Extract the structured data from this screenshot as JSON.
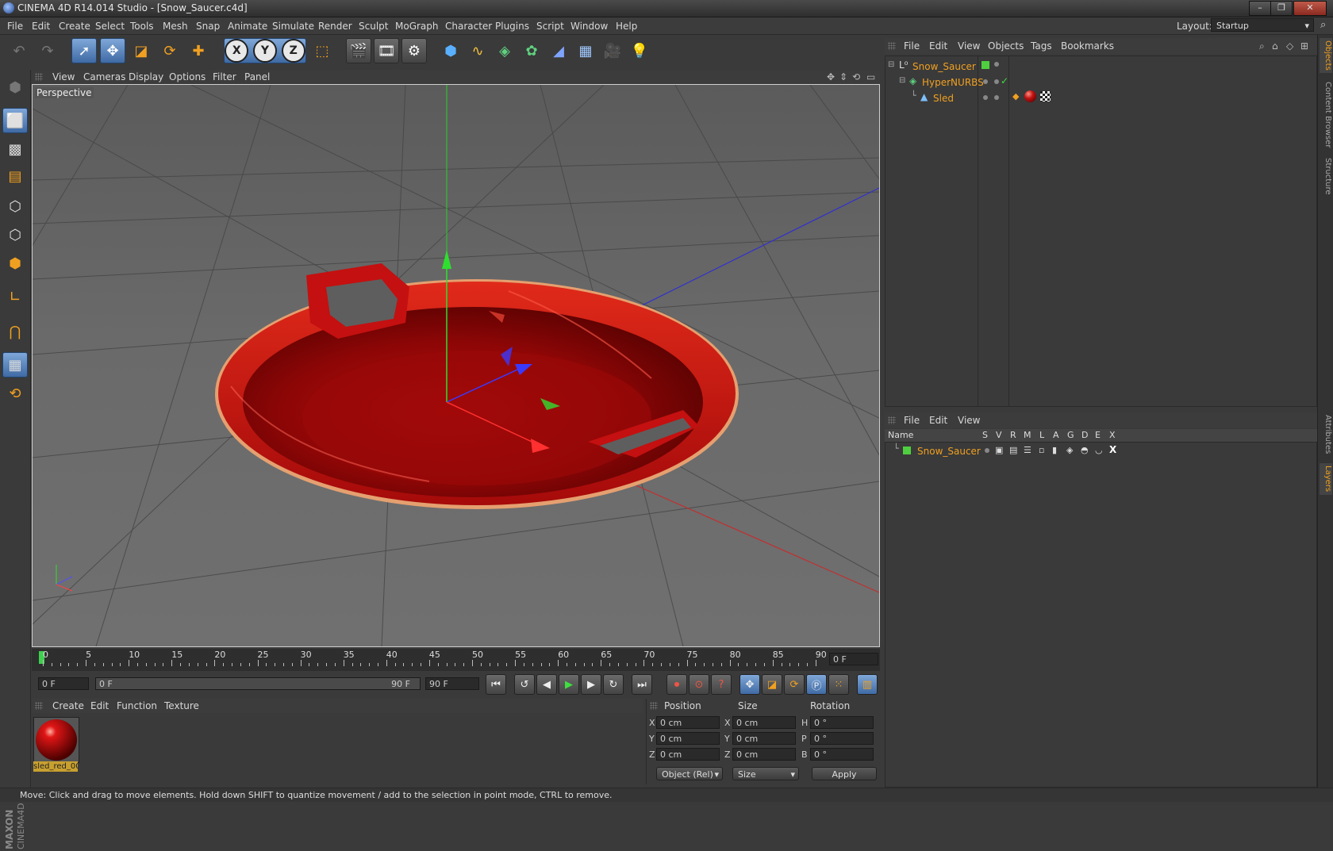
{
  "window": {
    "title": "CINEMA 4D R14.014 Studio - [Snow_Saucer.c4d]",
    "controls": [
      "–",
      "❐",
      "✕"
    ]
  },
  "menu": {
    "items": [
      "File",
      "Edit",
      "Create",
      "Select",
      "Tools",
      "Mesh",
      "Snap",
      "Animate",
      "Simulate",
      "Render",
      "Sculpt",
      "MoGraph",
      "Character",
      "Plugins",
      "Script",
      "Window",
      "Help"
    ],
    "layout_label": "Layout:",
    "layout_value": "Startup"
  },
  "viewport": {
    "menu": [
      "View",
      "Cameras",
      "Display",
      "Options",
      "Filter",
      "Panel"
    ],
    "label": "Perspective"
  },
  "timeline": {
    "ticks": [
      "0",
      "5",
      "10",
      "15",
      "20",
      "25",
      "30",
      "35",
      "40",
      "45",
      "50",
      "55",
      "60",
      "65",
      "70",
      "75",
      "80",
      "85",
      "90"
    ],
    "current_frame": "0 F"
  },
  "transport": {
    "start_field": "0 F",
    "range_start": "0 F",
    "range_end": "90 F",
    "end_field": "90 F"
  },
  "material_manager": {
    "menu": [
      "Create",
      "Edit",
      "Function",
      "Texture"
    ],
    "materials": [
      {
        "name": "sled_red_00"
      }
    ]
  },
  "coordinates": {
    "headers": [
      "Position",
      "Size",
      "Rotation"
    ],
    "rows": [
      {
        "axis": "X",
        "pos": "0 cm",
        "size_axis": "X",
        "size": "0 cm",
        "rot_axis": "H",
        "rot": "0 °"
      },
      {
        "axis": "Y",
        "pos": "0 cm",
        "size_axis": "Y",
        "size": "0 cm",
        "rot_axis": "P",
        "rot": "0 °"
      },
      {
        "axis": "Z",
        "pos": "0 cm",
        "size_axis": "Z",
        "size": "0 cm",
        "rot_axis": "B",
        "rot": "0 °"
      }
    ],
    "mode_select": "Object (Rel)",
    "size_select": "Size",
    "apply_label": "Apply"
  },
  "object_manager": {
    "menu": [
      "File",
      "Edit",
      "View",
      "Objects",
      "Tags",
      "Bookmarks"
    ],
    "objects": [
      {
        "name": "Snow_Saucer",
        "depth": 0
      },
      {
        "name": "HyperNURBS",
        "depth": 1
      },
      {
        "name": "Sled",
        "depth": 2
      }
    ]
  },
  "layer_manager": {
    "menu": [
      "File",
      "Edit",
      "View"
    ],
    "columns": [
      "Name",
      "S",
      "V",
      "R",
      "M",
      "L",
      "A",
      "G",
      "D",
      "E",
      "X"
    ],
    "layers": [
      {
        "name": "Snow_Saucer",
        "color": "#4fcf3f"
      }
    ]
  },
  "side_tabs": [
    "Objects",
    "Content Browser",
    "Structure",
    "Attributes",
    "Layers"
  ],
  "status_text": "Move: Click and drag to move elements. Hold down SHIFT to quantize movement / add to the selection in point mode, CTRL to remove.",
  "colors": {
    "accent": "#f0a020",
    "selection_blue": "#5f8bc4",
    "saucer_red": "#c81010"
  }
}
